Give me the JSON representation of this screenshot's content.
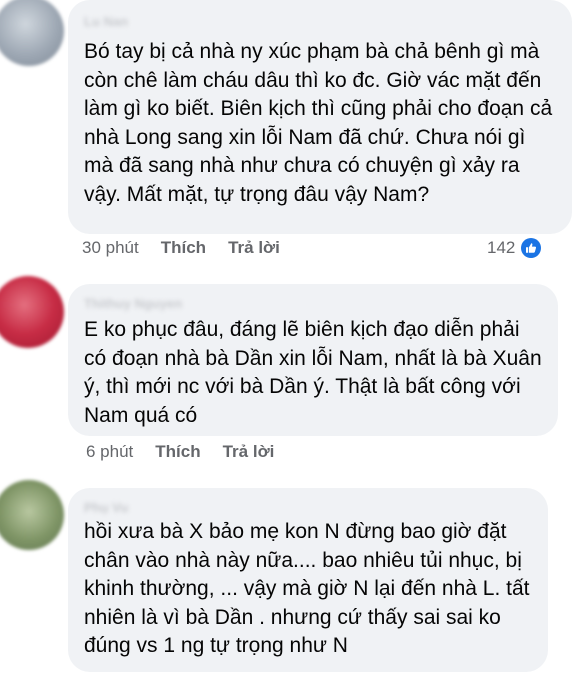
{
  "comments": [
    {
      "author": "Lu Nan",
      "text": "Bó tay bị cả nhà ny xúc phạm bà chả bênh gì mà còn chê làm cháu dâu thì ko đc. Giờ vác mặt đến làm gì ko biết. Biên kịch thì cũng phải cho đoạn cả nhà Long sang xin lỗi Nam đã chứ. Chưa nói gì mà đã sang nhà như chưa có chuyện gì xảy ra vậy. Mất mặt, tự trọng đâu vậy Nam?",
      "time": "30 phút",
      "like_label": "Thích",
      "reply_label": "Trả lời",
      "reaction_count": "142",
      "reaction_icon": "like-icon"
    },
    {
      "author": "Thithuy Nguyen",
      "text": "E ko phục đâu, đáng lẽ biên kịch đạo diễn phải có đoạn nhà bà Dần xin lỗi Nam, nhất là bà Xuân ý, thì mới nc với bà Dần ý. Thật là bất công với Nam quá có",
      "time": "6 phút",
      "like_label": "Thích",
      "reply_label": "Trả lời"
    },
    {
      "author": "Phụ Vu",
      "text": "hồi xưa bà X  bảo mẹ kon N đừng bao giờ đặt chân vào nhà này nữa.... bao nhiêu tủi nhục, bị khinh thường, ... vậy mà giờ N lại đến nhà L. tất nhiên là vì bà Dần . nhưng cứ thấy sai sai ko đúng vs 1 ng tự trọng như N"
    }
  ],
  "colors": {
    "bubble": "#f0f2f5",
    "meta_text": "#65676b",
    "like_blue": "#1b74e4"
  }
}
